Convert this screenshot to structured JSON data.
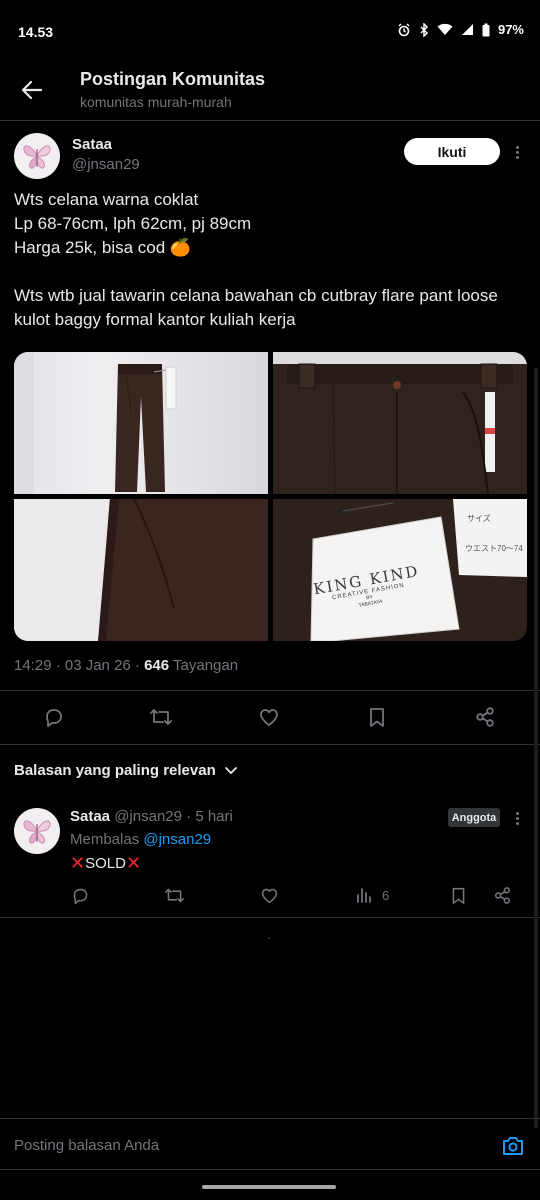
{
  "status_bar": {
    "time": "14.53",
    "battery": "97%"
  },
  "header": {
    "title": "Postingan Komunitas",
    "subtitle": "komunitas murah-murah"
  },
  "post": {
    "author_name": "Sataa",
    "author_handle": "@jnsan29",
    "follow_label": "Ikuti",
    "text_1": "Wts celana warna coklat\nLp 68-76cm, lph 62cm, pj 89cm\nHarga 25k, bisa cod 🍊",
    "text_2": "Wts wtb jual tawarin celana bawahan cb cutbray flare pant loose kulot baggy formal kantor kuliah kerja",
    "media_label_brand": "KING KIND",
    "media_label_tagline": "CREATIVE FASHION",
    "media_label_by": "BY",
    "media_label_maker": "TABATAYA",
    "media_tag_size": "サイズ",
    "media_tag_waist": "ウエスト70〜74",
    "time": "14:29 · 03 Jan 26 · ",
    "views": "646",
    "views_label": " Tayangan"
  },
  "actions": {
    "icons": [
      "reply-icon",
      "repost-icon",
      "like-icon",
      "bookmark-icon",
      "share-icon"
    ]
  },
  "sort": {
    "label": "Balasan yang paling relevan"
  },
  "reply": {
    "author_name": "Sataa",
    "author_handle": "@jnsan29",
    "separator": " · ",
    "age": "5 hari",
    "badge": "Anggota",
    "replying_prefix": "Membalas ",
    "replying_to": "@jnsan29",
    "text": "SOLD",
    "mark": "✕",
    "view_count": "6"
  },
  "compose": {
    "placeholder": "Posting balasan Anda"
  },
  "colors": {
    "background": "#000000",
    "text": "#e7e9ea",
    "muted": "#71767b",
    "link": "#1d9bf0",
    "divider": "#2f3336",
    "sold_mark": "#f4212e"
  }
}
